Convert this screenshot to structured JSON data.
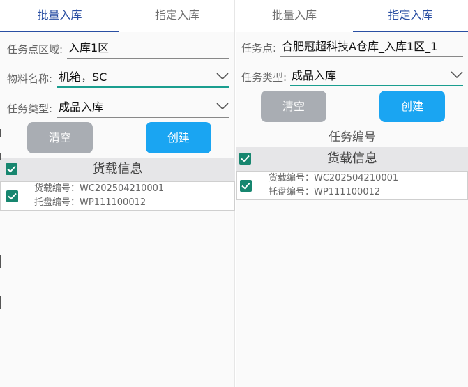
{
  "left_panel": {
    "tabs": [
      {
        "label": "批量入库",
        "active": true
      },
      {
        "label": "指定入库",
        "active": false
      }
    ],
    "fields": {
      "area": {
        "label": "任务点区域:",
        "value": "入库1区"
      },
      "material": {
        "label": "物料名称:",
        "value": "机箱，SC"
      },
      "task_type": {
        "label": "任务类型:",
        "value": "成品入库"
      }
    },
    "buttons": {
      "clear": "清空",
      "create": "创建"
    },
    "cargo": {
      "header": "货载信息",
      "rows": [
        {
          "cargo_no": "货载编号：WC202504210001",
          "pallet_no": "托盘编号：WP111100012"
        }
      ]
    }
  },
  "right_panel": {
    "tabs": [
      {
        "label": "批量入库",
        "active": false
      },
      {
        "label": "指定入库",
        "active": true
      }
    ],
    "fields": {
      "task_point": {
        "label": "任务点:",
        "value": "合肥冠超科技A仓库_入库1区_1"
      },
      "task_type": {
        "label": "任务类型:",
        "value": "成品入库"
      }
    },
    "buttons": {
      "clear": "清空",
      "create": "创建"
    },
    "task_no_label": "任务编号",
    "cargo": {
      "header": "货载信息",
      "rows": [
        {
          "cargo_no": "货载编号：WC202504210001",
          "pallet_no": "托盘编号：WP111100012"
        }
      ]
    }
  },
  "colors": {
    "accent_tab": "#2a4fa3",
    "checkbox": "#17866f",
    "create_button": "#1aa5f2",
    "clear_button": "#a9adb3",
    "focus_underline": "#1a9e8f"
  }
}
